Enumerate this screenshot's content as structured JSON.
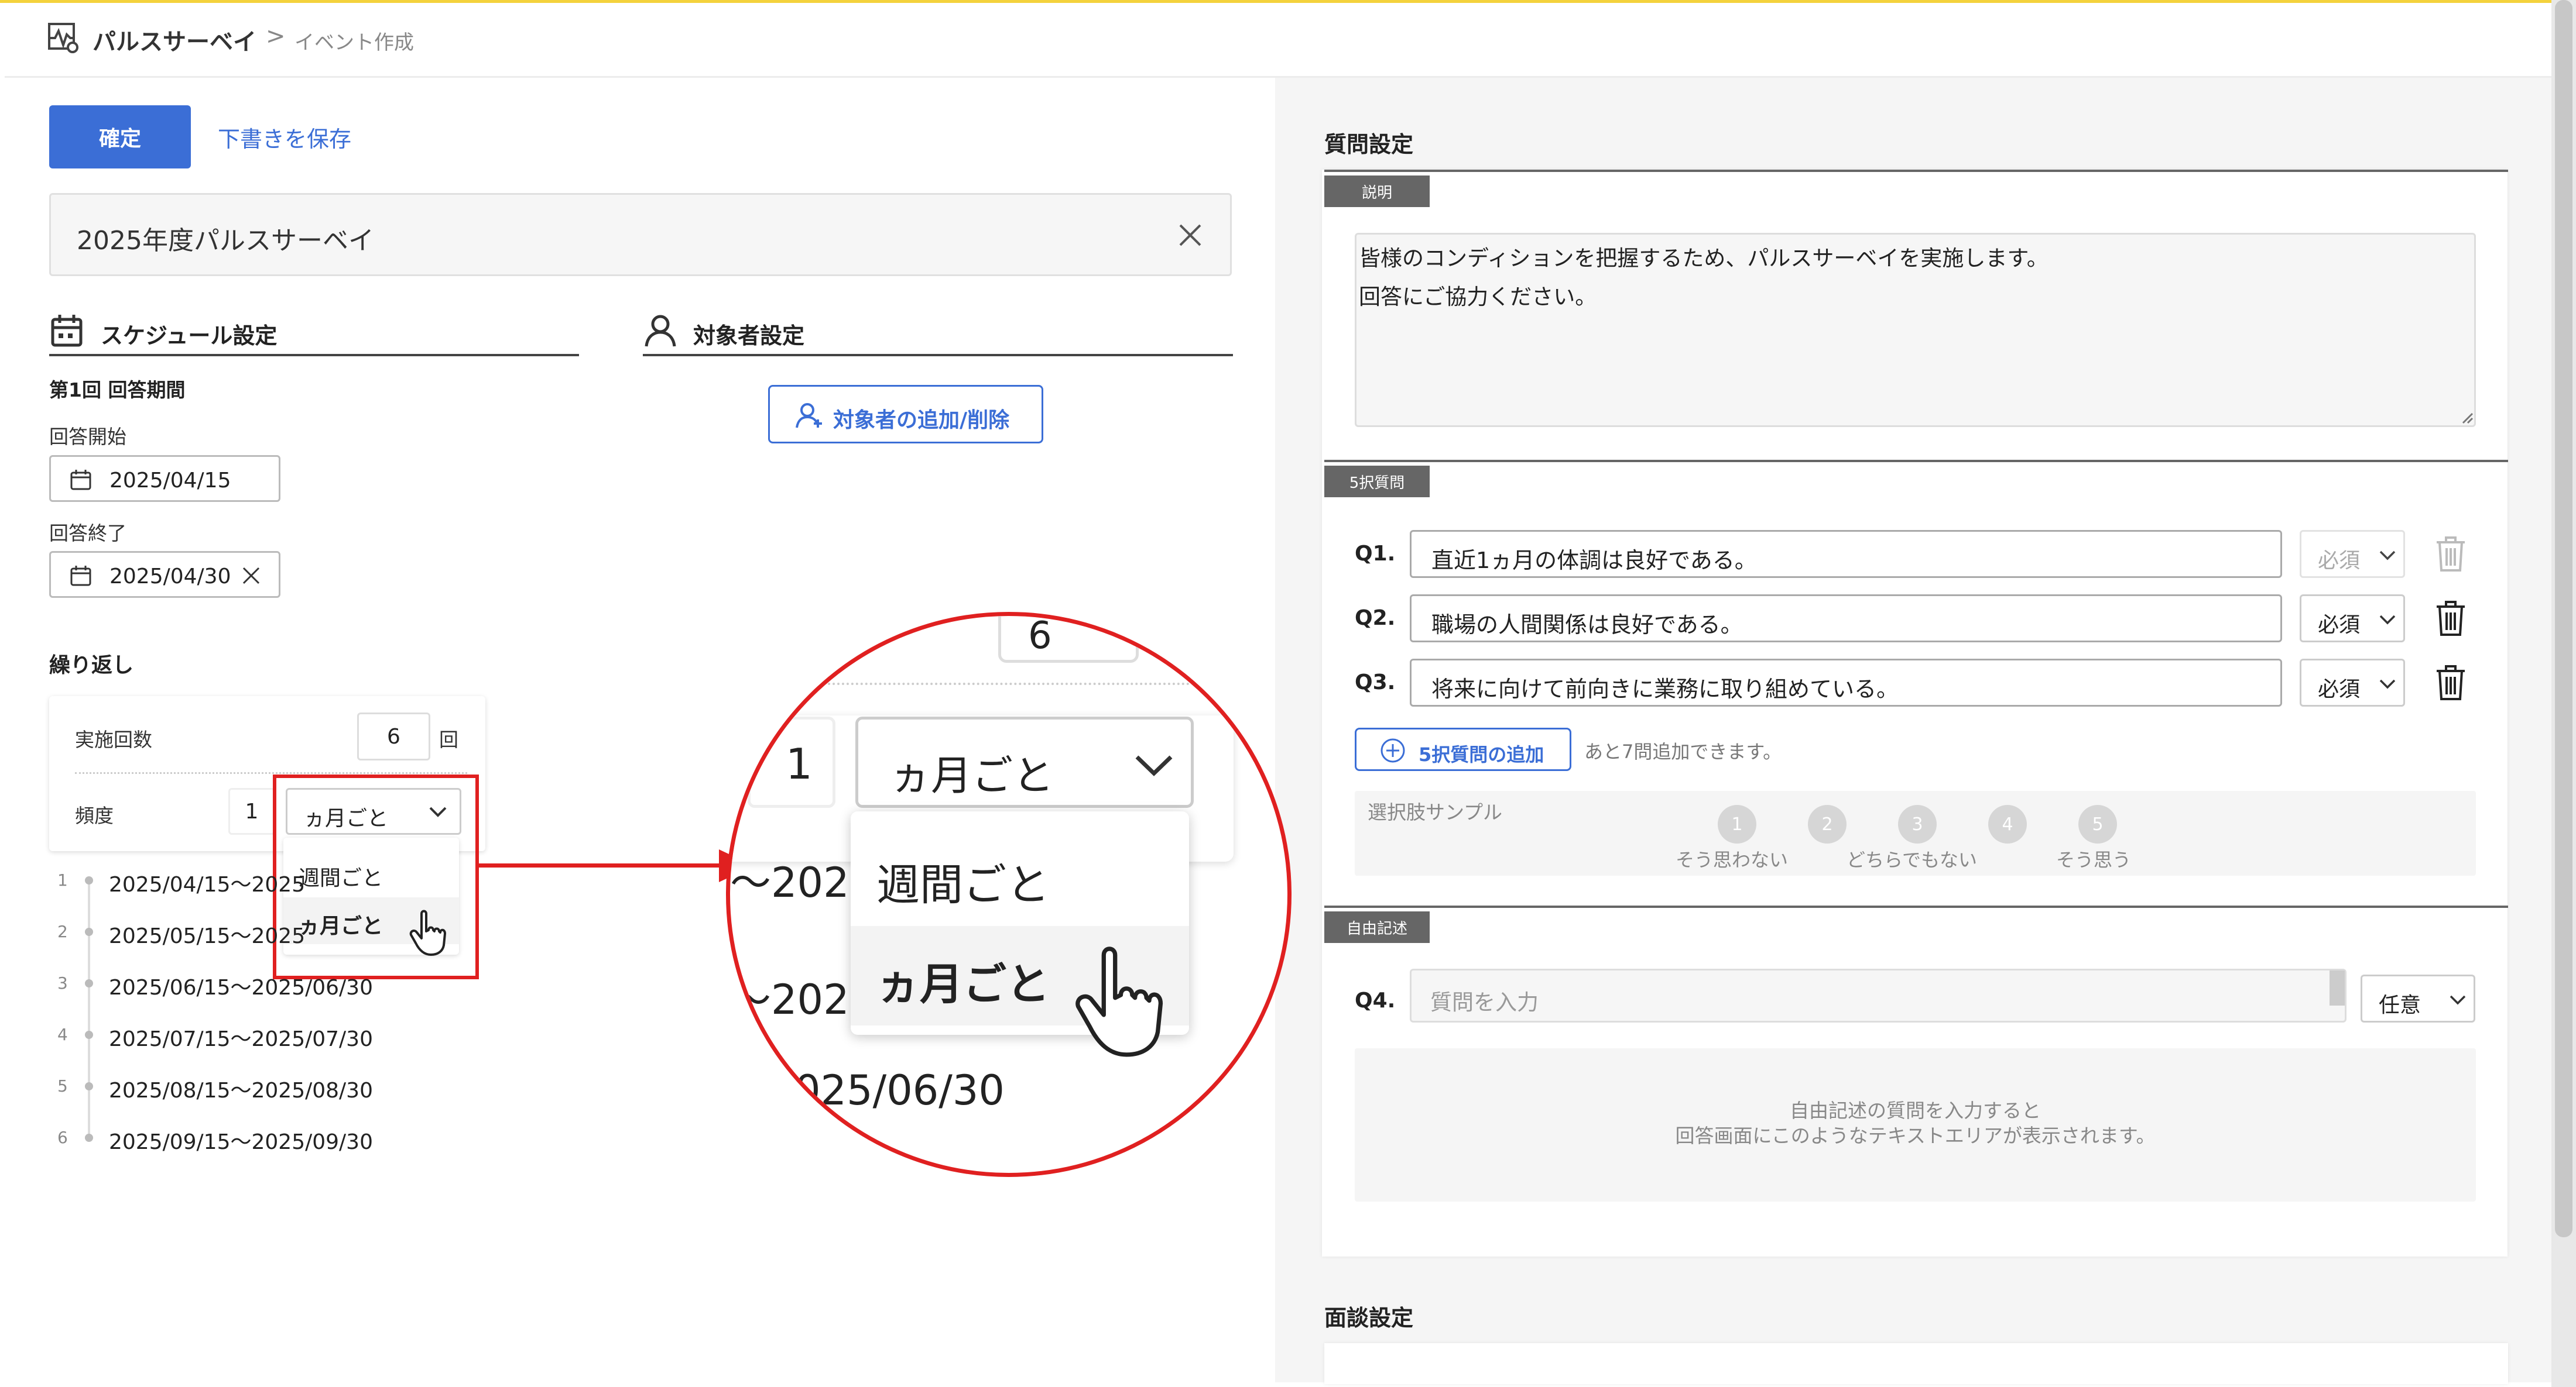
{
  "header": {
    "title": "パルスサーベイ",
    "separator": ">",
    "breadcrumb": "イベント作成"
  },
  "actions": {
    "confirm_label": "確定",
    "save_draft_label": "下書きを保存"
  },
  "event_title": {
    "value": "2025年度パルスサーベイ"
  },
  "schedule": {
    "section_title": "スケジュール設定",
    "round_label": "第1回 回答期間",
    "start_label": "回答開始",
    "start_date": "2025/04/15",
    "end_label": "回答終了",
    "end_date": "2025/04/30",
    "repeat_label": "繰り返し",
    "count_label": "実施回数",
    "count_value": "6",
    "count_unit": "回",
    "freq_label": "頻度",
    "freq_value": "1",
    "freq_selected": "ヵ月ごと",
    "freq_options": [
      "週間ごと",
      "ヵ月ごと"
    ],
    "items": [
      {
        "n": "1",
        "text": "2025/04/15～2025"
      },
      {
        "n": "2",
        "text": "2025/05/15～2025"
      },
      {
        "n": "3",
        "text": "2025/06/15～2025/06/30"
      },
      {
        "n": "4",
        "text": "2025/07/15～2025/07/30"
      },
      {
        "n": "5",
        "text": "2025/08/15～2025/08/30"
      },
      {
        "n": "6",
        "text": "2025/09/15～2025/09/30"
      }
    ]
  },
  "target": {
    "section_title": "対象者設定",
    "add_button": "対象者の追加/削除"
  },
  "zoom": {
    "top_value": "6",
    "value": "1",
    "selected": "ヵ月ごと",
    "options": [
      "週間ごと",
      "ヵ月ごと"
    ],
    "bg_text_1": "～202",
    "bg_text_2": "～202",
    "bg_text_3": "025/06/30"
  },
  "questions": {
    "section_title": "質問設定",
    "desc_tag": "説明",
    "desc_line1": "皆様のコンディションを把握するため、パルスサーベイを実施します。",
    "desc_line2": "回答にご協力ください。",
    "choice_tag": "5択質問",
    "items": [
      {
        "q": "Q1.",
        "text": "直近1ヵ月の体調は良好である。",
        "req": "必須",
        "disabled": true
      },
      {
        "q": "Q2.",
        "text": "職場の人間関係は良好である。",
        "req": "必須",
        "disabled": false
      },
      {
        "q": "Q3.",
        "text": "将来に向けて前向きに業務に取り組めている。",
        "req": "必須",
        "disabled": false
      }
    ],
    "add_choice_button": "5択質問の追加",
    "remaining_text": "あと7問追加できます。",
    "sample_label": "選択肢サンプル",
    "scale": [
      "1",
      "2",
      "3",
      "4",
      "5"
    ],
    "scale_labels": {
      "1": "そう思わない",
      "3": "どちらでもない",
      "5": "そう思う"
    },
    "free_tag": "自由記述",
    "free_q": "Q4.",
    "free_placeholder": "質問を入力",
    "free_req": "任意",
    "free_hint1": "自由記述の質問を入力すると",
    "free_hint2": "回答画面にこのようなテキストエリアが表示されます。"
  },
  "interview": {
    "section_title": "面談設定"
  },
  "colors": {
    "primary": "#3b6ed6",
    "highlight": "#e02020",
    "accent_line": "#f4d23c"
  }
}
